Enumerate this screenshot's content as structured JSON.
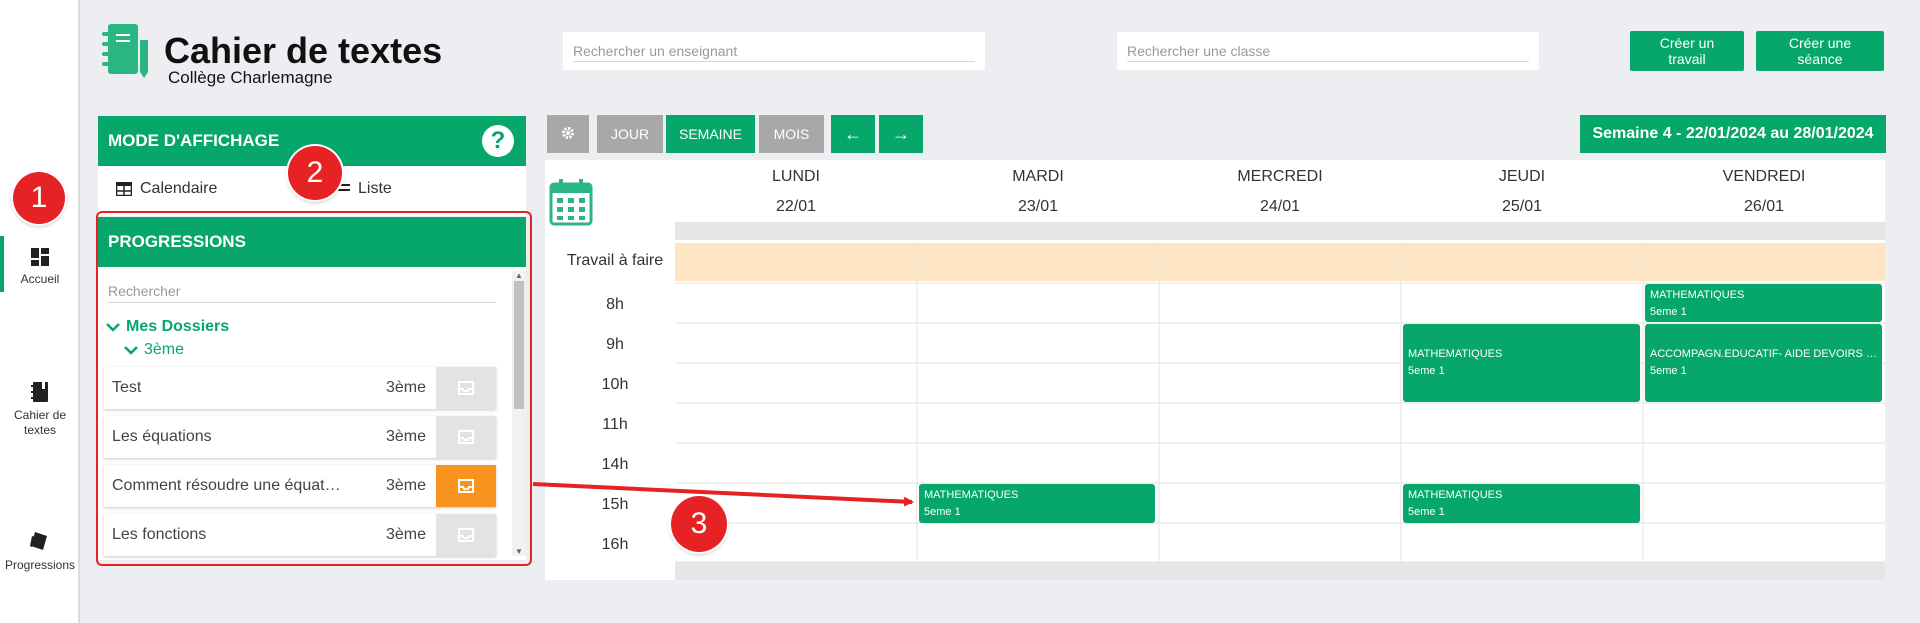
{
  "app": {
    "title": "Cahier de textes",
    "school": "Collège Charlemagne"
  },
  "colors": {
    "accent": "#07a66b",
    "orange": "#f7931e",
    "annotation": "#e62225",
    "todo_row": "#fde5c4"
  },
  "nav": [
    {
      "label": "Accueil",
      "icon": "dashboard-icon",
      "active": true
    },
    {
      "label": "Cahier de textes",
      "icon": "notebook-icon"
    },
    {
      "label": "Progressions",
      "icon": "stack-icon"
    }
  ],
  "search": {
    "teacher_placeholder": "Rechercher un enseignant",
    "class_placeholder": "Rechercher une classe"
  },
  "actions": {
    "create_work": "Créer un travail",
    "create_session": "Créer une séance"
  },
  "display_mode": {
    "title": "MODE D'AFFICHAGE",
    "help": "?",
    "calendar_label": "Calendaire",
    "list_label": "Liste"
  },
  "progressions": {
    "title": "PROGRESSIONS",
    "search_placeholder": "Rechercher",
    "folder": "Mes Dossiers",
    "subfolder": "3ème",
    "items": [
      {
        "name": "Test",
        "level": "3ème",
        "highlight": false
      },
      {
        "name": "Les équations",
        "level": "3ème",
        "highlight": false
      },
      {
        "name": "Comment résoudre une équation",
        "level": "3ème",
        "highlight": true
      },
      {
        "name": "Les fonctions",
        "level": "3ème",
        "highlight": false
      }
    ]
  },
  "annotations": [
    "1",
    "2",
    "3"
  ],
  "calendar": {
    "views": {
      "day": "JOUR",
      "week": "SEMAINE",
      "month": "MOIS"
    },
    "prev": "←",
    "next": "→",
    "week_label": "Semaine 4 - 22/01/2024 au 28/01/2024",
    "days": [
      {
        "name": "LUNDI",
        "date": "22/01"
      },
      {
        "name": "MARDI",
        "date": "23/01"
      },
      {
        "name": "MERCREDI",
        "date": "24/01"
      },
      {
        "name": "JEUDI",
        "date": "25/01"
      },
      {
        "name": "VENDREDI",
        "date": "26/01"
      }
    ],
    "todo_label": "Travail à faire",
    "hours": [
      "8h",
      "9h",
      "10h",
      "11h",
      "14h",
      "15h",
      "16h"
    ],
    "events": [
      {
        "title": "MATHEMATIQUES",
        "class": "5eme 1",
        "day": "VENDREDI",
        "start": "8h"
      },
      {
        "title": "MATHEMATIQUES",
        "class": "5eme 1",
        "day": "JEUDI",
        "start": "9h"
      },
      {
        "title": "ACCOMPAGN.EDUCATIF- AIDE DEVOIRS LEC...",
        "class": "5eme 1",
        "day": "VENDREDI",
        "start": "9h"
      },
      {
        "title": "MATHEMATIQUES",
        "class": "5eme 1",
        "day": "MARDI",
        "start": "15h"
      },
      {
        "title": "MATHEMATIQUES",
        "class": "5eme 1",
        "day": "JEUDI",
        "start": "15h"
      }
    ]
  }
}
